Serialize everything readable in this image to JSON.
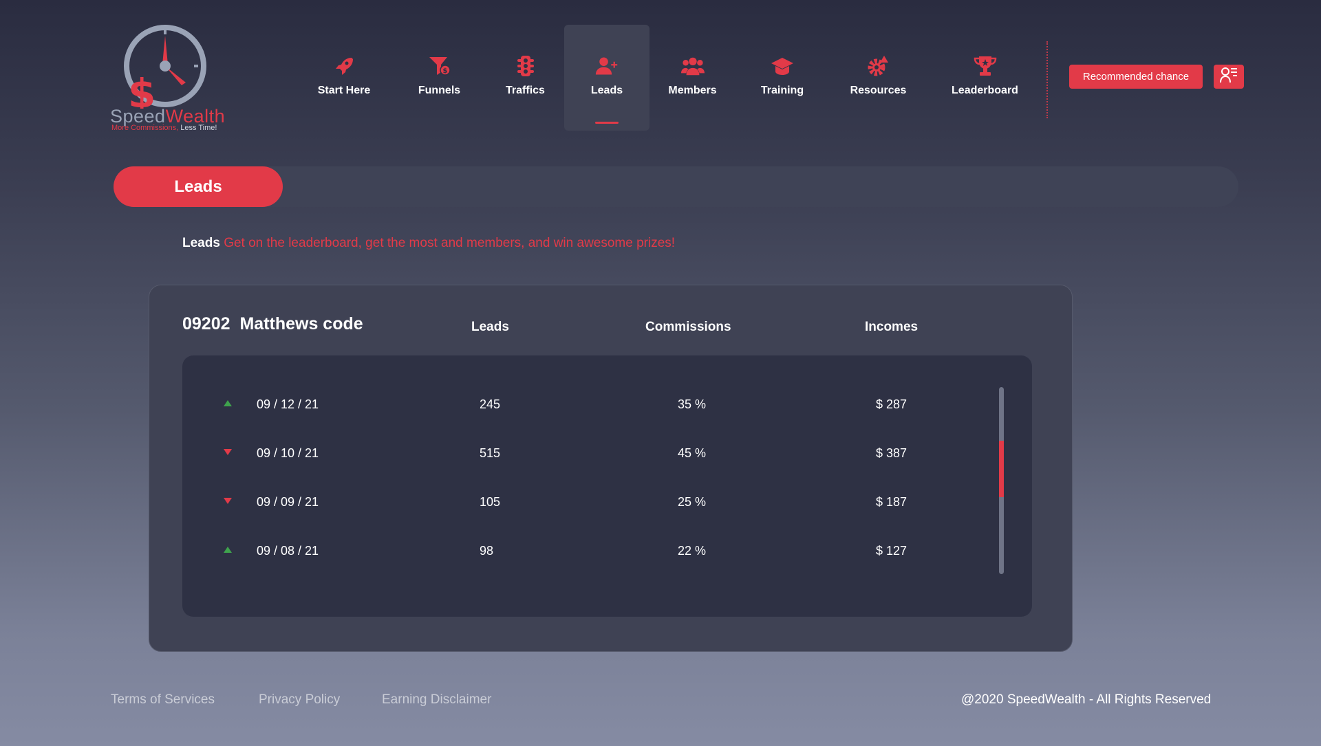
{
  "brand": {
    "name_part1": "Speed",
    "name_part2": "Wealth",
    "tagline_part1": "More Commissions,",
    "tagline_part2": " Less Time!"
  },
  "nav": [
    {
      "label": "Start Here",
      "icon": "rocket-icon"
    },
    {
      "label": "Funnels",
      "icon": "funnel-dollar-icon"
    },
    {
      "label": "Traffics",
      "icon": "traffic-light-icon"
    },
    {
      "label": "Leads",
      "icon": "user-plus-icon",
      "active": true
    },
    {
      "label": "Members",
      "icon": "users-icon"
    },
    {
      "label": "Training",
      "icon": "graduation-cap-icon"
    },
    {
      "label": "Resources",
      "icon": "gear-icon"
    },
    {
      "label": "Leaderboard",
      "icon": "trophy-icon"
    }
  ],
  "header": {
    "recommended_label": "Recommended chance",
    "profile_icon": "user-list-icon"
  },
  "page": {
    "title": "Leads",
    "subtitle_strong": "Leads",
    "subtitle_text": "Get on the leaderboard, get the most and members, and win awesome prizes!"
  },
  "table": {
    "code": "09202",
    "code_label": "Matthews code",
    "columns": [
      "Leads",
      "Commissions",
      "Incomes"
    ],
    "rows": [
      {
        "trend": "up",
        "date": "09 / 12 / 21",
        "leads": "245",
        "commissions": "35 %",
        "incomes": "$ 287"
      },
      {
        "trend": "down",
        "date": "09 / 10 / 21",
        "leads": "515",
        "commissions": "45 %",
        "incomes": "$ 387"
      },
      {
        "trend": "down",
        "date": "09 / 09 / 21",
        "leads": "105",
        "commissions": "25 %",
        "incomes": "$ 187"
      },
      {
        "trend": "up",
        "date": "09 / 08 / 21",
        "leads": "98",
        "commissions": "22 %",
        "incomes": "$ 127"
      }
    ]
  },
  "footer": {
    "links": [
      "Terms of Services",
      "Privacy Policy",
      "Earning Disclaimer"
    ],
    "copyright": "@2020 SpeedWealth - All Rights Reserved"
  },
  "colors": {
    "accent": "#e23a48",
    "up": "#3fa34d",
    "down": "#e23a48"
  }
}
